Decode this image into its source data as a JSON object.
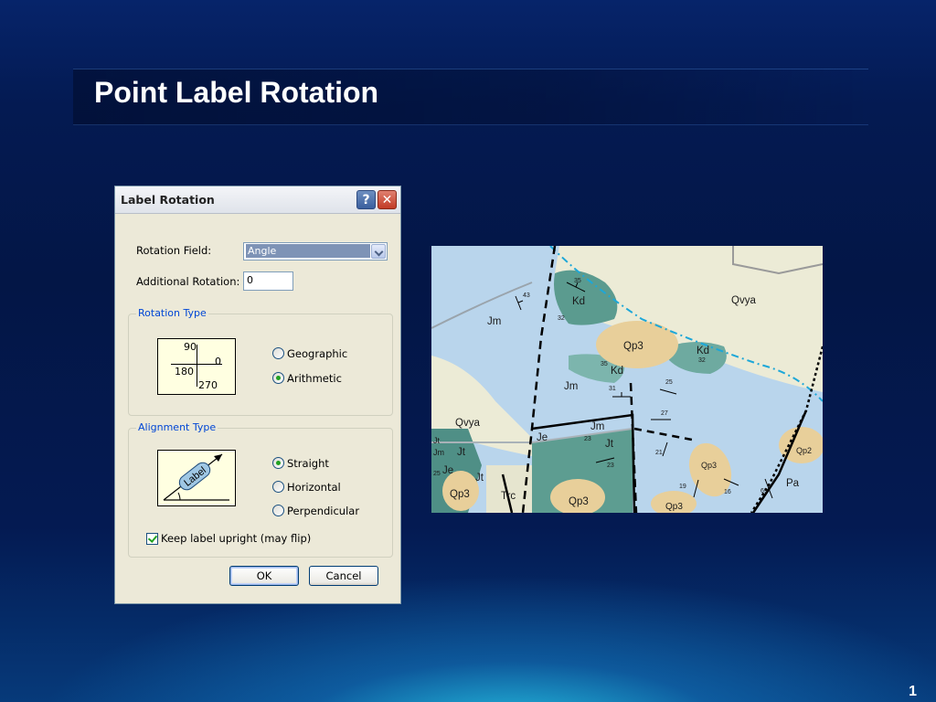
{
  "slide": {
    "title": "Point Label Rotation",
    "page_number": "1"
  },
  "dialog": {
    "title": "Label Rotation",
    "help_label": "?",
    "close_label": "✕",
    "rotation_field_label": "Rotation Field:",
    "rotation_field_value": "Angle",
    "additional_rotation_label": "Additional Rotation:",
    "additional_rotation_value": "0",
    "rotation_type": {
      "label": "Rotation Type",
      "preview": {
        "top": "90",
        "right": "0",
        "left": "180",
        "bottom": "270"
      },
      "options": [
        {
          "label": "Geographic",
          "selected": false
        },
        {
          "label": "Arithmetic",
          "selected": true
        }
      ]
    },
    "alignment_type": {
      "label": "Alignment Type",
      "preview_label": "Label",
      "options": [
        {
          "label": "Straight",
          "selected": true
        },
        {
          "label": "Horizontal",
          "selected": false
        },
        {
          "label": "Perpendicular",
          "selected": false
        }
      ]
    },
    "keep_upright_label": "Keep label upright (may flip)",
    "keep_upright_checked": true,
    "ok_label": "OK",
    "cancel_label": "Cancel"
  },
  "map": {
    "unit_labels": [
      "Kd",
      "Qvya",
      "Jm",
      "Qp3",
      "Kd",
      "Kd",
      "Jm",
      "Qvya",
      "Jm",
      "Je",
      "Jt",
      "Jt",
      "Jm",
      "Je",
      "Qp2",
      "Qp3",
      "Qp3",
      "Jt",
      "Trc",
      "Qp3",
      "Pa",
      "Qp3",
      "Jt"
    ],
    "dip_values": [
      "43",
      "35",
      "32",
      "32",
      "35",
      "25",
      "31",
      "27",
      "23",
      "23",
      "21",
      "19",
      "16",
      "69",
      "25"
    ]
  }
}
